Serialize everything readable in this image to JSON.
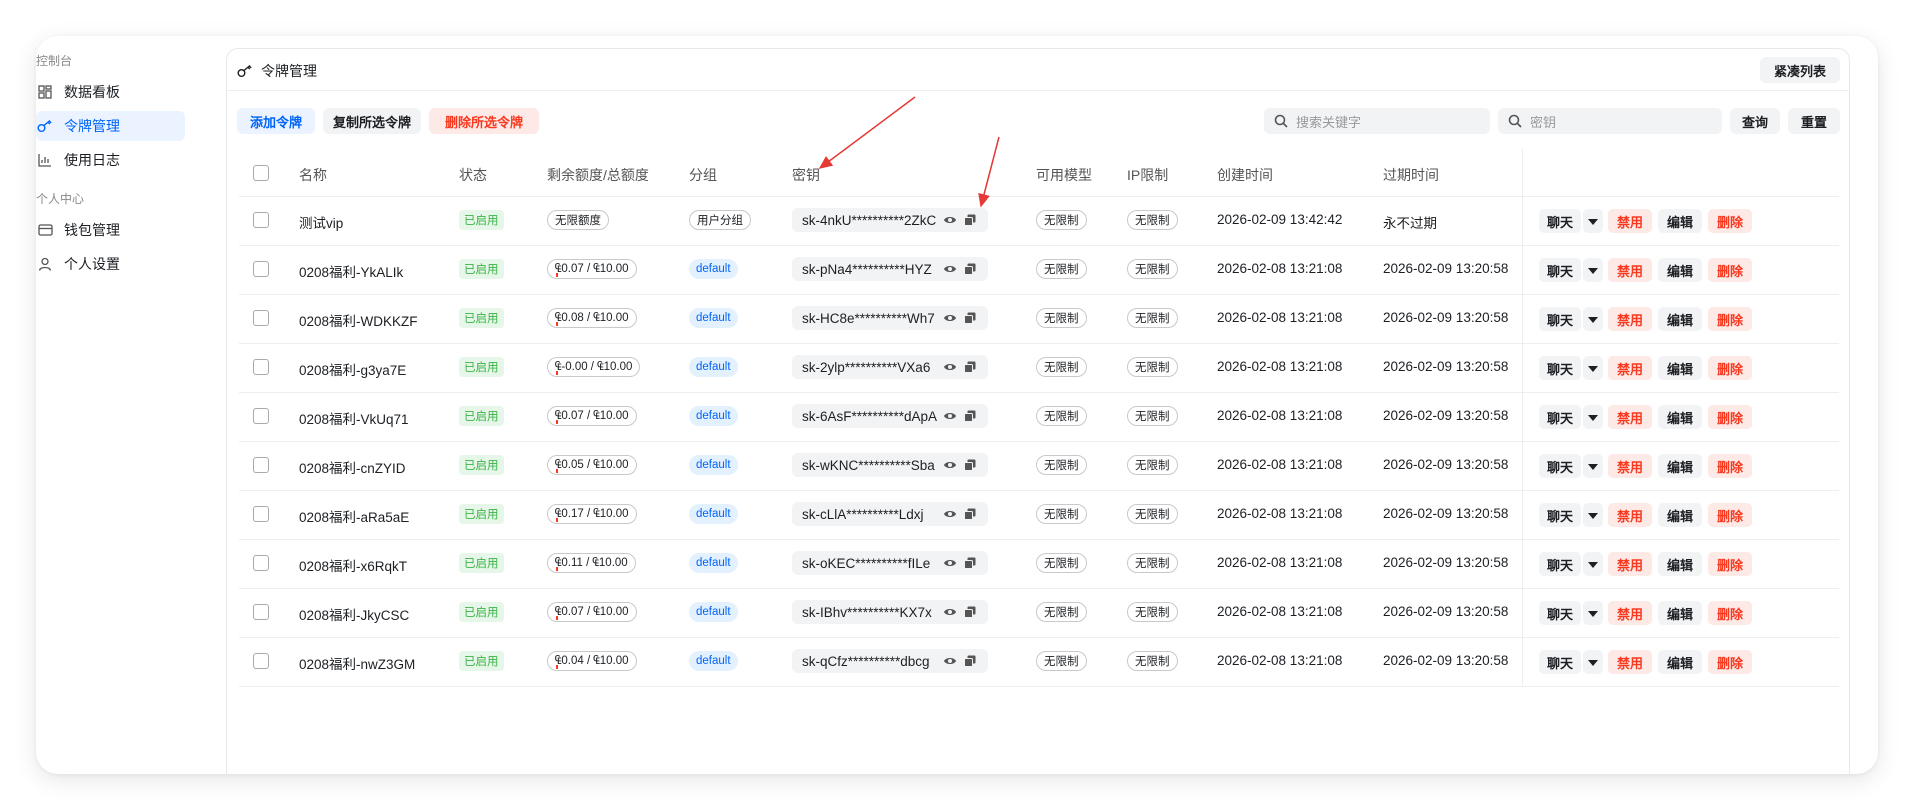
{
  "sidebar": {
    "section_console": "控制台",
    "section_personal": "个人中心",
    "items": [
      {
        "label": "数据看板",
        "icon": "dashboard-icon"
      },
      {
        "label": "令牌管理",
        "icon": "key-icon",
        "active": true
      },
      {
        "label": "使用日志",
        "icon": "chart-icon"
      },
      {
        "label": "钱包管理",
        "icon": "wallet-icon"
      },
      {
        "label": "个人设置",
        "icon": "user-icon"
      }
    ]
  },
  "header": {
    "title": "令牌管理",
    "compact_list": "紧凑列表"
  },
  "toolbar": {
    "add_token": "添加令牌",
    "copy_selected": "复制所选令牌",
    "delete_selected": "删除所选令牌",
    "search_keyword_placeholder": "搜索关键字",
    "key_placeholder": "密钥",
    "query": "查询",
    "reset": "重置"
  },
  "table": {
    "columns": [
      "名称",
      "状态",
      "剩余额度/总额度",
      "分组",
      "密钥",
      "可用模型",
      "IP限制",
      "创建时间",
      "过期时间"
    ],
    "actions": {
      "chat": "聊天",
      "disable": "禁用",
      "edit": "编辑",
      "delete": "删除"
    },
    "rows": [
      {
        "name": "测试vip",
        "status": "已启用",
        "quota": "无限额度",
        "group": "用户分组",
        "key": "sk-4nkU**********2ZkC",
        "models": "无限制",
        "ip": "无限制",
        "created": "2026-02-09 13:42:42",
        "expires": "永不过期"
      },
      {
        "name": "0208福利-YkALIk",
        "status": "已启用",
        "quota": "₠0.07 / ₠10.00",
        "group": "default",
        "key": "sk-pNa4**********HYZ",
        "models": "无限制",
        "ip": "无限制",
        "created": "2026-02-08 13:21:08",
        "expires": "2026-02-09 13:20:58"
      },
      {
        "name": "0208福利-WDKKZF",
        "status": "已启用",
        "quota": "₠0.08 / ₠10.00",
        "group": "default",
        "key": "sk-HC8e**********Wh7",
        "models": "无限制",
        "ip": "无限制",
        "created": "2026-02-08 13:21:08",
        "expires": "2026-02-09 13:20:58"
      },
      {
        "name": "0208福利-g3ya7E",
        "status": "已启用",
        "quota": "₠-0.00 / ₠10.00",
        "group": "default",
        "key": "sk-2ylp**********VXa6",
        "models": "无限制",
        "ip": "无限制",
        "created": "2026-02-08 13:21:08",
        "expires": "2026-02-09 13:20:58"
      },
      {
        "name": "0208福利-VkUq71",
        "status": "已启用",
        "quota": "₠0.07 / ₠10.00",
        "group": "default",
        "key": "sk-6AsF**********dApA",
        "models": "无限制",
        "ip": "无限制",
        "created": "2026-02-08 13:21:08",
        "expires": "2026-02-09 13:20:58"
      },
      {
        "name": "0208福利-cnZYID",
        "status": "已启用",
        "quota": "₠0.05 / ₠10.00",
        "group": "default",
        "key": "sk-wKNC**********Sba",
        "models": "无限制",
        "ip": "无限制",
        "created": "2026-02-08 13:21:08",
        "expires": "2026-02-09 13:20:58"
      },
      {
        "name": "0208福利-aRa5aE",
        "status": "已启用",
        "quota": "₠0.17 / ₠10.00",
        "group": "default",
        "key": "sk-cLlA**********Ldxj",
        "models": "无限制",
        "ip": "无限制",
        "created": "2026-02-08 13:21:08",
        "expires": "2026-02-09 13:20:58"
      },
      {
        "name": "0208福利-x6RqkT",
        "status": "已启用",
        "quota": "₠0.11 / ₠10.00",
        "group": "default",
        "key": "sk-oKEC**********fILe",
        "models": "无限制",
        "ip": "无限制",
        "created": "2026-02-08 13:21:08",
        "expires": "2026-02-09 13:20:58"
      },
      {
        "name": "0208福利-JkyCSC",
        "status": "已启用",
        "quota": "₠0.07 / ₠10.00",
        "group": "default",
        "key": "sk-IBhv**********KX7x",
        "models": "无限制",
        "ip": "无限制",
        "created": "2026-02-08 13:21:08",
        "expires": "2026-02-09 13:20:58"
      },
      {
        "name": "0208福利-nwZ3GM",
        "status": "已启用",
        "quota": "₠0.04 / ₠10.00",
        "group": "default",
        "key": "sk-qCfz**********dbcg",
        "models": "无限制",
        "ip": "无限制",
        "created": "2026-02-08 13:21:08",
        "expires": "2026-02-09 13:20:58"
      }
    ]
  },
  "colors": {
    "primary": "#0064fa",
    "danger": "#f93920",
    "success": "#3bb346",
    "annotation": "#e53935"
  }
}
